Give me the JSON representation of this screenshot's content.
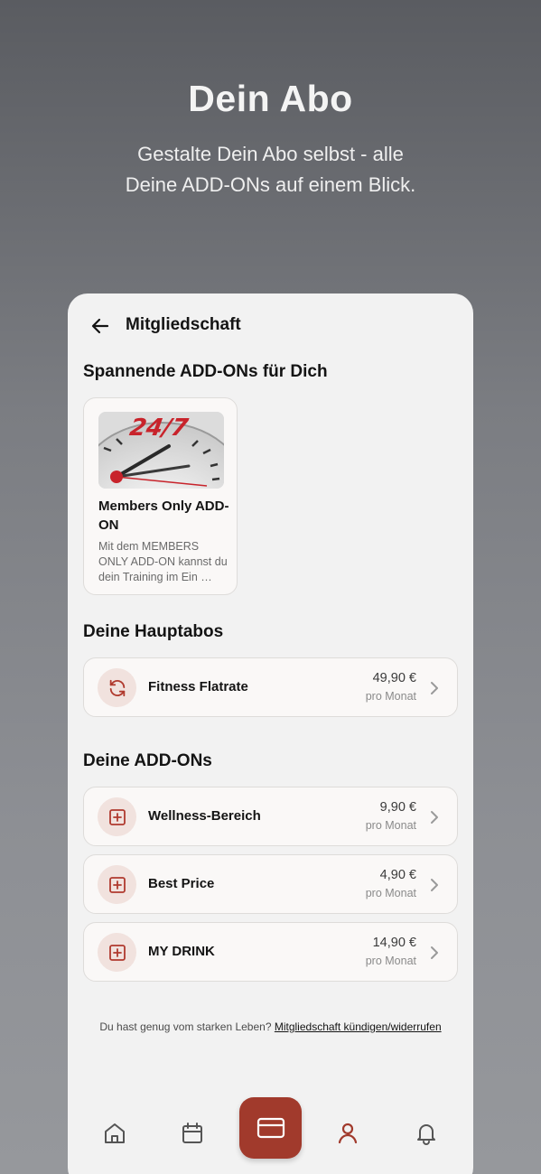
{
  "promo": {
    "title": "Dein Abo",
    "subtitle_line1": "Gestalte Dein Abo selbst - alle",
    "subtitle_line2": "Deine ADD-ONs auf einem Blick."
  },
  "topbar": {
    "title": "Mitgliedschaft",
    "back_icon": "arrow-left-icon"
  },
  "featured": {
    "section_title": "Spannende ADD-ONs für Dich",
    "card": {
      "name": "Members Only ADD-ON",
      "description": "Mit dem MEMBERS ONLY ADD-ON kannst du dein Training im Ein …",
      "image_text": "24/7"
    }
  },
  "main_subscriptions": {
    "section_title": "Deine Hauptabos",
    "items": [
      {
        "label": "Fitness Flatrate",
        "price": "49,90 €",
        "unit": "pro Monat",
        "icon": "refresh-icon"
      }
    ]
  },
  "addons": {
    "section_title": "Deine ADD-ONs",
    "items": [
      {
        "label": "Wellness-Bereich",
        "price": "9,90 €",
        "unit": "pro Monat",
        "icon": "plus-square-icon"
      },
      {
        "label": "Best Price",
        "price": "4,90 €",
        "unit": "pro Monat",
        "icon": "plus-square-icon"
      },
      {
        "label": "MY DRINK",
        "price": "14,90 €",
        "unit": "pro Monat",
        "icon": "plus-square-icon"
      }
    ]
  },
  "footer": {
    "text": "Du hast genug vom starken Leben?",
    "link": "Mitgliedschaft kündigen/widerrufen"
  },
  "nav": {
    "items": [
      "home-icon",
      "calendar-icon",
      "card-icon",
      "user-icon",
      "bell-icon"
    ],
    "active": "user-icon"
  },
  "colors": {
    "accent": "#a13a2c",
    "icon_bg": "#f1e2de",
    "background": "#f2f2f2"
  }
}
